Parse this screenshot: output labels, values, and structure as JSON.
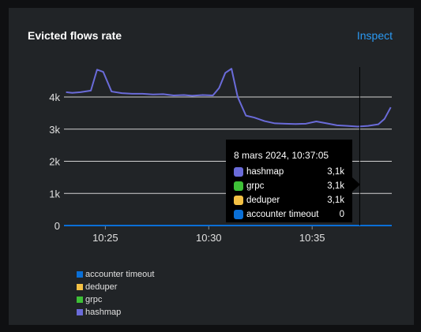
{
  "card": {
    "title": "Evicted flows rate",
    "inspect_label": "Inspect"
  },
  "chart_data": {
    "type": "line",
    "title": "",
    "xlabel": "",
    "ylabel": "",
    "x_ticks": [
      "10:25",
      "10:30",
      "10:35"
    ],
    "x_tick_minutes": [
      25,
      30,
      35
    ],
    "y_ticks": [
      "0",
      "1k",
      "2k",
      "3k",
      "4k"
    ],
    "y_tick_values": [
      0,
      1000,
      2000,
      3000,
      4000
    ],
    "ylim": [
      0,
      4000
    ],
    "grid": "horizontal",
    "x_minutes": [
      23.1,
      23.4,
      23.8,
      24.3,
      24.6,
      24.9,
      25.3,
      25.8,
      26.3,
      26.8,
      27.3,
      27.8,
      28.3,
      28.8,
      29.2,
      29.7,
      30.2,
      30.5,
      30.8,
      31.1,
      31.4,
      31.8,
      32.2,
      32.7,
      33.2,
      33.7,
      34.2,
      34.7,
      35.2,
      35.7,
      36.2,
      36.7,
      37.2,
      37.7,
      38.2,
      38.5,
      38.8
    ],
    "series": [
      {
        "name": "hashmap",
        "color": "#6a6bd9",
        "values": [
          4150,
          4130,
          4150,
          4200,
          4850,
          4780,
          4170,
          4120,
          4100,
          4100,
          4080,
          4090,
          4050,
          4060,
          4040,
          4060,
          4050,
          4280,
          4750,
          4880,
          4000,
          3420,
          3360,
          3250,
          3180,
          3170,
          3160,
          3170,
          3240,
          3180,
          3120,
          3100,
          3080,
          3100,
          3150,
          3320,
          3680
        ]
      },
      {
        "name": "grpc",
        "color": "#3ec037",
        "values": []
      },
      {
        "name": "deduper",
        "color": "#f4c145",
        "values": []
      },
      {
        "name": "accounter timeout",
        "color": "#0a6fd6",
        "values": [
          0,
          0
        ]
      }
    ],
    "legend_placement": "bottom-left",
    "legend": [
      "accounter timeout",
      "deduper",
      "grpc",
      "hashmap"
    ],
    "cursor_minute": 37.3
  },
  "tooltip": {
    "title": "8 mars 2024, 10:37:05",
    "rows": [
      {
        "name": "hashmap",
        "value": "3,1k",
        "color": "#6a6bd9"
      },
      {
        "name": "grpc",
        "value": "3,1k",
        "color": "#3ec037"
      },
      {
        "name": "deduper",
        "value": "3,1k",
        "color": "#f4c145"
      },
      {
        "name": "accounter timeout",
        "value": "0",
        "color": "#0a6fd6"
      }
    ]
  }
}
